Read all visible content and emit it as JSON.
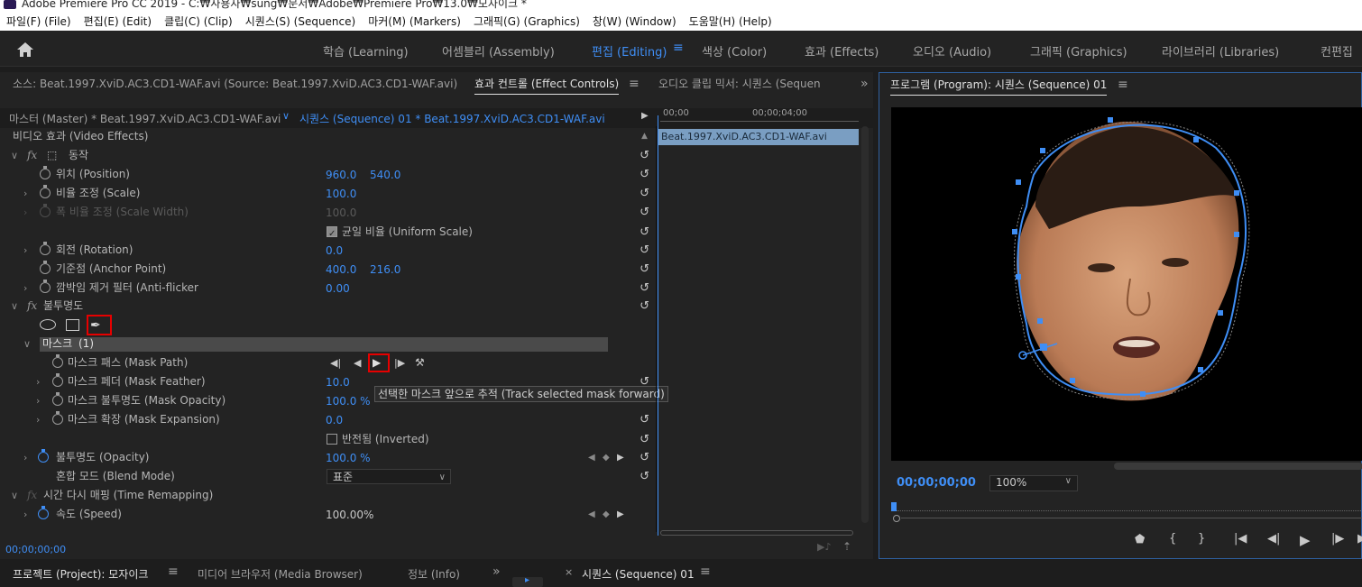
{
  "titlebar": {
    "text": "Adobe Premiere Pro CC 2019 - C:₩사용자₩sung₩문서₩Adobe₩Premiere Pro₩13.0₩모자이크 *"
  },
  "menu": [
    "파일(F) (File)",
    "편집(E) (Edit)",
    "클립(C) (Clip)",
    "시퀀스(S) (Sequence)",
    "마커(M) (Markers)",
    "그래픽(G) (Graphics)",
    "창(W) (Window)",
    "도움말(H) (Help)"
  ],
  "workspaces": [
    "학습 (Learning)",
    "어셈블리 (Assembly)",
    "편집 (Editing)",
    "색상 (Color)",
    "효과 (Effects)",
    "오디오 (Audio)",
    "그래픽 (Graphics)",
    "라이브러리 (Libraries)",
    "컨편집"
  ],
  "workspace_active": "편집 (Editing)",
  "left_tabs": {
    "source": "소스: Beat.1997.XviD.AC3.CD1-WAF.avi (Source: Beat.1997.XviD.AC3.CD1-WAF.avi)",
    "effect_controls": "효과 컨트롤 (Effect Controls)",
    "audio_mixer": "오디오 클립 믹서: 시퀀스 (Sequen",
    "more": "»"
  },
  "ec_header": {
    "master": "마스터 (Master) * Beat.1997.XviD.AC3.CD1-WAF.avi",
    "sequence": "시퀀스 (Sequence) 01 * Beat.1997.XviD.AC3.CD1-WAF.avi",
    "time_start": "00;00",
    "time_mid": "00;00;04;00"
  },
  "video_effects_label": "비디오 효과 (Video Effects)",
  "motion_label": "동작",
  "position": {
    "label": "위치 (Position)",
    "x": "960.0",
    "y": "540.0"
  },
  "scale": {
    "label": "비율 조정 (Scale)",
    "value": "100.0"
  },
  "scale_width": {
    "label": "폭 비율 조정 (Scale Width)",
    "value": "100.0"
  },
  "uniform_scale": "균일 비율 (Uniform Scale)",
  "rotation": {
    "label": "회전 (Rotation)",
    "value": "0.0"
  },
  "anchor": {
    "label": "기준점 (Anchor Point)",
    "x": "400.0",
    "y": "216.0"
  },
  "antiflicker": {
    "label": "깜박임 제거 필터 (Anti-flicker",
    "value": "0.00"
  },
  "opacity_group": "불투명도",
  "mask": {
    "label": "마스크",
    "count": "(1)"
  },
  "mask_path": "마스크 패스 (Mask Path)",
  "mask_feather": {
    "label": "마스크 페더 (Mask Feather)",
    "value": "10.0"
  },
  "mask_opacity": {
    "label": "마스크 불투명도 (Mask Opacity)",
    "value": "100.0 %"
  },
  "mask_expansion": {
    "label": "마스크 확장 (Mask Expansion)",
    "value": "0.0"
  },
  "inverted": "반전됨 (Inverted)",
  "opacity": {
    "label": "불투명도 (Opacity)",
    "value": "100.0 %"
  },
  "blend": {
    "label": "혼합 모드 (Blend Mode)",
    "value": "표준"
  },
  "time_remap": "시간 다시 매핑 (Time Remapping)",
  "speed": {
    "label": "속도 (Speed)",
    "value": "100.00%"
  },
  "tooltip": "선택한 마스크 앞으로 추적 (Track selected mask forward)",
  "ec_timecode": "00;00;00;00",
  "clip_name": "Beat.1997.XviD.AC3.CD1-WAF.avi",
  "program": {
    "title": "프로그램 (Program): 시퀀스 (Sequence) 01",
    "timecode": "00;00;00;00",
    "zoom": "100%"
  },
  "bottom_tabs": {
    "project": "프로젝트 (Project): 모자이크",
    "media_browser": "미디어 브라우저 (Media Browser)",
    "info": "정보 (Info)",
    "more": "»",
    "sequence": "시퀀스 (Sequence) 01"
  },
  "colors": {
    "accent": "#3f8ef5",
    "highlight": "#e60000"
  }
}
